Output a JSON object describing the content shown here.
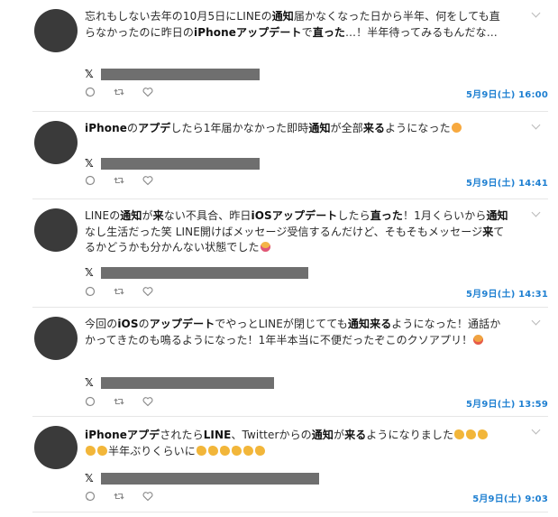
{
  "posts": [
    {
      "segments": [
        {
          "t": "忘れもしない去年の10月5日に",
          "b": false
        },
        {
          "t": "LINE",
          "b": false
        },
        {
          "t": "の",
          "b": false
        },
        {
          "t": "通知",
          "b": true
        },
        {
          "t": "届かなくなった日から半年、何をしても直らなかったのに昨日の",
          "b": false
        },
        {
          "t": "iPhone",
          "b": true
        },
        {
          "t": "アップデート",
          "b": true
        },
        {
          "t": "で",
          "b": false
        },
        {
          "t": "直った",
          "b": true
        },
        {
          "t": "…！半年待ってみるもんだな…",
          "b": false
        }
      ],
      "date": "5月9日(土) 16:00",
      "source_icon": "x-logo"
    },
    {
      "segments": [
        {
          "t": "iPhone",
          "b": true
        },
        {
          "t": "の",
          "b": false
        },
        {
          "t": "アプデ",
          "b": true
        },
        {
          "t": "したら1年届かなかった即時",
          "b": false
        },
        {
          "t": "通知",
          "b": true
        },
        {
          "t": "が全部",
          "b": false
        },
        {
          "t": "来る",
          "b": true
        },
        {
          "t": "ようになった",
          "b": false
        }
      ],
      "emoji_end": "face",
      "date": "5月9日(土) 14:41",
      "source_icon": "x-logo"
    },
    {
      "segments": [
        {
          "t": "LINE",
          "b": false
        },
        {
          "t": "の",
          "b": false
        },
        {
          "t": "通知",
          "b": true
        },
        {
          "t": "が",
          "b": false
        },
        {
          "t": "来",
          "b": true
        },
        {
          "t": "ない不具合、昨日",
          "b": false
        },
        {
          "t": "iOSアップデート",
          "b": true
        },
        {
          "t": "したら",
          "b": false
        },
        {
          "t": "直った",
          "b": true
        },
        {
          "t": "！1月くらいから",
          "b": false
        },
        {
          "t": "通知",
          "b": true
        },
        {
          "t": "なし生活だった笑 LINE開けばメッセージ受信するんだけど、そもそもメッセージ",
          "b": false
        },
        {
          "t": "来",
          "b": true
        },
        {
          "t": "てるかどうかも分かんない状態でした",
          "b": false
        }
      ],
      "emoji_end": "grin",
      "date": "5月9日(土) 14:31",
      "source_icon": "x-logo"
    },
    {
      "segments": [
        {
          "t": "今回の",
          "b": false
        },
        {
          "t": "iOS",
          "b": true
        },
        {
          "t": "の",
          "b": false
        },
        {
          "t": "アップデート",
          "b": true
        },
        {
          "t": "でやっとLINEが閉じてても",
          "b": false
        },
        {
          "t": "通知来る",
          "b": true
        },
        {
          "t": "ようになった！通話かかってきたのも鳴るようになった！1年半本当に不便だったぞこのクソアプリ！",
          "b": false
        }
      ],
      "emoji_end": "angry",
      "date": "5月9日(土) 13:59",
      "source_icon": "x-logo"
    },
    {
      "segments": [
        {
          "t": "iPhoneアプデ",
          "b": true
        },
        {
          "t": "されたら",
          "b": false
        },
        {
          "t": "LINE",
          "b": true
        },
        {
          "t": "、Twitterからの",
          "b": false
        },
        {
          "t": "通知",
          "b": true
        },
        {
          "t": "が",
          "b": false
        },
        {
          "t": "来る",
          "b": true
        },
        {
          "t": "ようになりました",
          "b": false
        }
      ],
      "claps_after_text": 3,
      "line2_prefix_claps": 2,
      "line2_text": "半年ぶりくらいに",
      "claps_end": 6,
      "date": "5月9日(土) 9:03",
      "source_icon": "x-logo"
    }
  ],
  "source_logo_text": "𝕏",
  "action_icons": [
    "reply-icon",
    "retweet-icon",
    "like-icon"
  ],
  "colors": {
    "date": "#1d7fd1",
    "avatar": "#3a3a3a",
    "redaction": "#6f6f6f"
  }
}
